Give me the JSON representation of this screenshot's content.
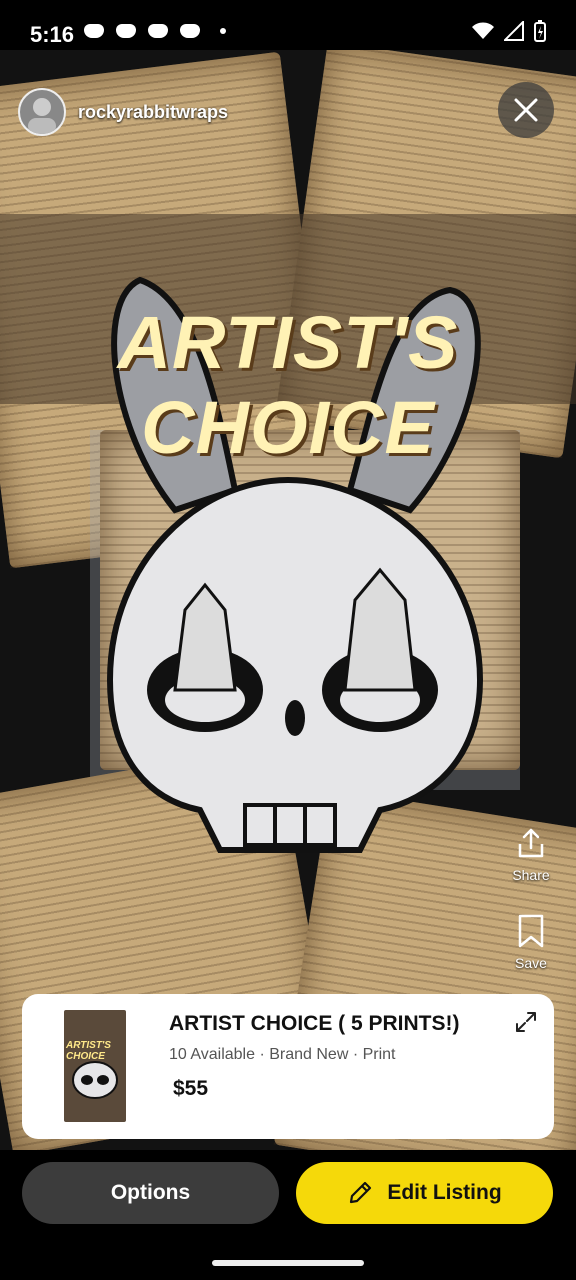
{
  "status_bar": {
    "time": "5:16"
  },
  "post": {
    "username": "rockyrabbitwraps",
    "banner_text": "ARTIST'S CHOICE"
  },
  "actions": {
    "share_label": "Share",
    "save_label": "Save"
  },
  "listing": {
    "title": "ARTIST CHOICE ( 5 PRINTS!)",
    "meta": "10 Available · Brand New · Print",
    "price": "$55",
    "thumb_text": "ARTIST'S CHOICE"
  },
  "buttons": {
    "options_label": "Options",
    "edit_label": "Edit Listing"
  },
  "colors": {
    "accent": "#f5d90a",
    "card_bg": "#ffffff"
  }
}
